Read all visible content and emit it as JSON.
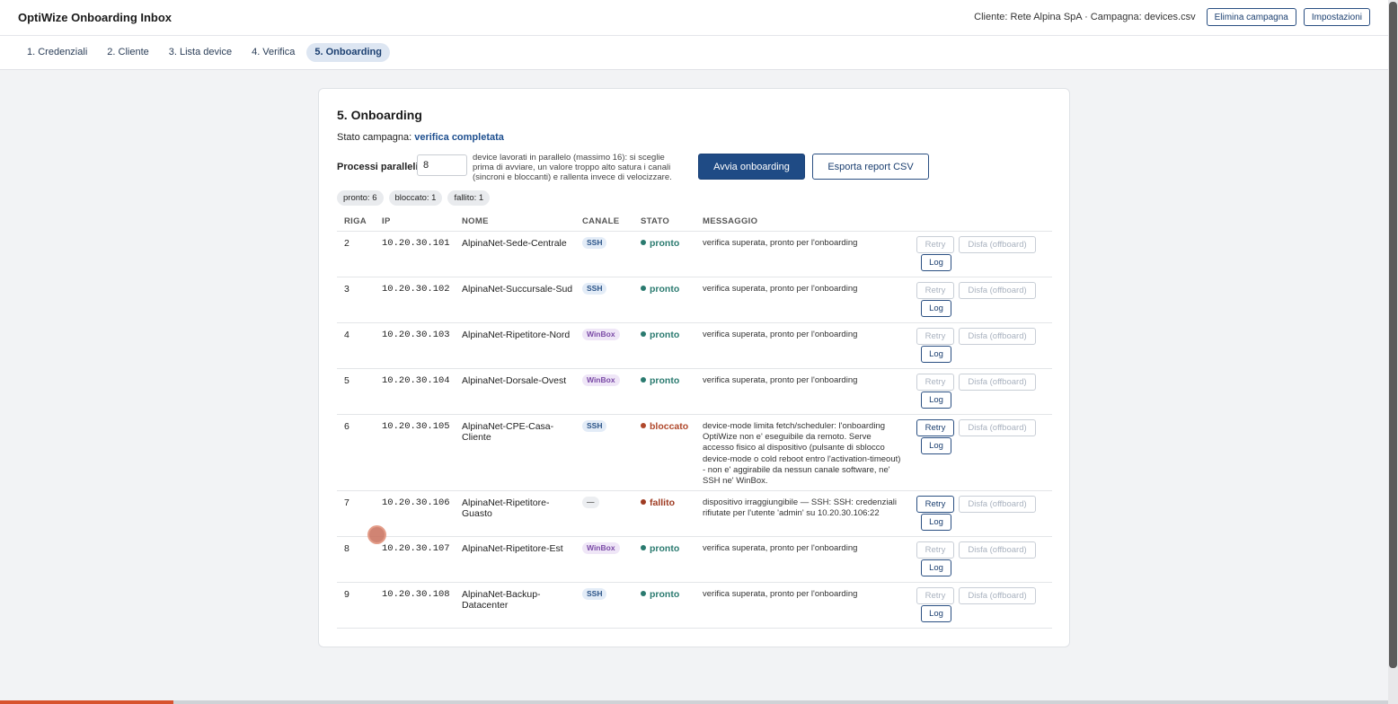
{
  "app": {
    "title": "OptiWize Onboarding Inbox"
  },
  "header": {
    "client_info": "Cliente: Rete Alpina SpA · Campagna: devices.csv",
    "delete_label": "Elimina campagna",
    "settings_label": "Impostazioni"
  },
  "tabs": [
    {
      "label": "1. Credenziali",
      "active": false
    },
    {
      "label": "2. Cliente",
      "active": false
    },
    {
      "label": "3. Lista device",
      "active": false
    },
    {
      "label": "4. Verifica",
      "active": false
    },
    {
      "label": "5. Onboarding",
      "active": true
    }
  ],
  "card": {
    "title": "5. Onboarding",
    "state_label": "Stato campagna: ",
    "state_value": "verifica completata",
    "proc_label": "Processi paralleli",
    "proc_value": "8",
    "proc_hint": "device lavorati in parallelo (massimo 16): si sceglie prima di avviare, un valore troppo alto satura i canali (sincroni e bloccanti) e rallenta invece di velocizzare.",
    "start_label": "Avvia onboarding",
    "export_label": "Esporta report CSV"
  },
  "chips": [
    "pronto: 6",
    "bloccato: 1",
    "fallito: 1"
  ],
  "table": {
    "headers": {
      "riga": "RIGA",
      "ip": "IP",
      "nome": "NOME",
      "canale": "CANALE",
      "stato": "STATO",
      "messaggio": "MESSAGGIO"
    },
    "retry_label": "Retry",
    "disfa_label": "Disfa (offboard)",
    "log_label": "Log",
    "rows": [
      {
        "riga": "2",
        "ip": "10.20.30.101",
        "nome": "AlpinaNet-Sede-Centrale",
        "canale": "SSH",
        "stato": "pronto",
        "messaggio": "verifica superata, pronto per l'onboarding"
      },
      {
        "riga": "3",
        "ip": "10.20.30.102",
        "nome": "AlpinaNet-Succursale-Sud",
        "canale": "SSH",
        "stato": "pronto",
        "messaggio": "verifica superata, pronto per l'onboarding"
      },
      {
        "riga": "4",
        "ip": "10.20.30.103",
        "nome": "AlpinaNet-Ripetitore-Nord",
        "canale": "WinBox",
        "stato": "pronto",
        "messaggio": "verifica superata, pronto per l'onboarding"
      },
      {
        "riga": "5",
        "ip": "10.20.30.104",
        "nome": "AlpinaNet-Dorsale-Ovest",
        "canale": "WinBox",
        "stato": "pronto",
        "messaggio": "verifica superata, pronto per l'onboarding"
      },
      {
        "riga": "6",
        "ip": "10.20.30.105",
        "nome": "AlpinaNet-CPE-Casa-Cliente",
        "canale": "SSH",
        "stato": "bloccato",
        "messaggio": "device-mode limita fetch/scheduler: l'onboarding OptiWize non e' eseguibile da remoto. Serve accesso fisico al dispositivo (pulsante di sblocco device-mode o cold reboot entro l'activation-timeout) - non e' aggirabile da nessun canale software, ne' SSH ne' WinBox."
      },
      {
        "riga": "7",
        "ip": "10.20.30.106",
        "nome": "AlpinaNet-Ripetitore-Guasto",
        "canale": "—",
        "stato": "fallito",
        "messaggio": "dispositivo irraggiungibile — SSH: SSH: credenziali rifiutate per l'utente 'admin' su 10.20.30.106:22"
      },
      {
        "riga": "8",
        "ip": "10.20.30.107",
        "nome": "AlpinaNet-Ripetitore-Est",
        "canale": "WinBox",
        "stato": "pronto",
        "messaggio": "verifica superata, pronto per l'onboarding"
      },
      {
        "riga": "9",
        "ip": "10.20.30.108",
        "nome": "AlpinaNet-Backup-Datacenter",
        "canale": "SSH",
        "stato": "pronto",
        "messaggio": "verifica superata, pronto per l'onboarding"
      }
    ]
  },
  "colors": {
    "accent": "#1f4b85",
    "pronto": "#2a7a6f",
    "bloccato": "#b0482b",
    "fallito": "#9e3b22",
    "ssh_bg": "#e3ecf7",
    "ssh_fg": "#2b5488",
    "winbox_bg": "#efe6f7",
    "winbox_fg": "#7a4aa6",
    "none_bg": "#eceef1",
    "none_fg": "#666666"
  },
  "progress": {
    "fraction": 0.125
  }
}
